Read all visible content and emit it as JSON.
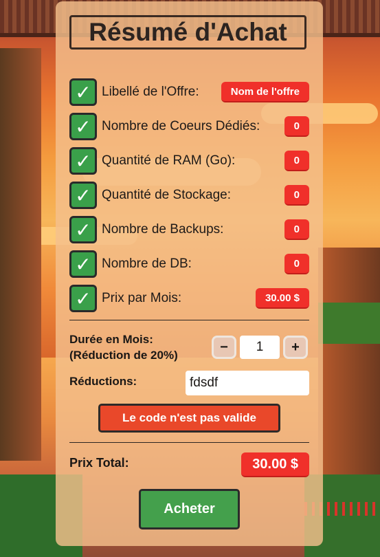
{
  "title": "Résumé d'Achat",
  "items": [
    {
      "label": "Libellé de l'Offre:",
      "value": "Nom de l'offre",
      "check_icon": "check-icon"
    },
    {
      "label": "Nombre de Coeurs Dédiés:",
      "value": "0",
      "check_icon": "check-icon"
    },
    {
      "label": "Quantité de RAM (Go):",
      "value": "0",
      "check_icon": "check-icon"
    },
    {
      "label": "Quantité de Stockage:",
      "value": "0",
      "check_icon": "check-icon"
    },
    {
      "label": "Nombre de Backups:",
      "value": "0",
      "check_icon": "check-icon"
    },
    {
      "label": "Nombre de DB:",
      "value": "0",
      "check_icon": "check-icon"
    },
    {
      "label": "Prix par Mois:",
      "value": "30.00 $",
      "check_icon": "check-icon"
    }
  ],
  "duration": {
    "label_line1": "Durée en Mois:",
    "label_line2": "(Réduction de 20%)",
    "minus": "−",
    "plus": "+",
    "value": "1"
  },
  "reductions": {
    "label": "Réductions:",
    "value": "fdsdf"
  },
  "error_message": "Le code n'est pas valide",
  "total": {
    "label": "Prix Total:",
    "value": "30.00 $"
  },
  "buy_button": "Acheter",
  "colors": {
    "accent_red": "#f0302a",
    "check_green": "#3aa04a",
    "buy_green": "#44a04c",
    "error_orange": "#e9482a"
  }
}
